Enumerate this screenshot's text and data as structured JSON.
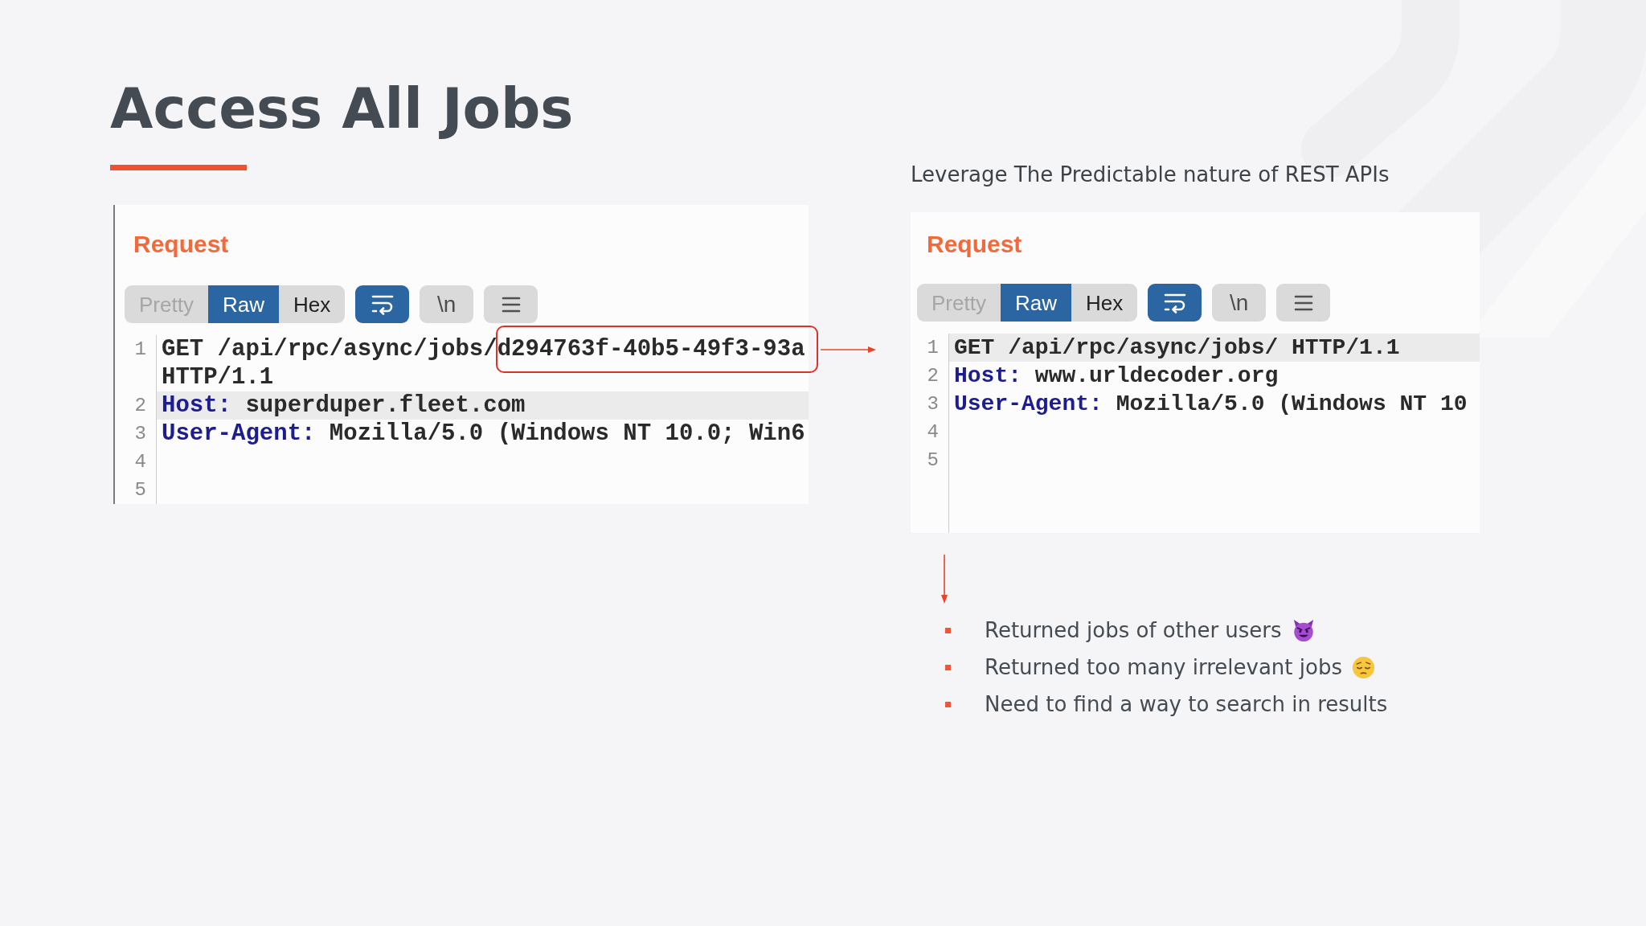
{
  "slide": {
    "title": "Access All Jobs",
    "subtitle": "Leverage The Predictable nature of REST APIs"
  },
  "panels": [
    {
      "heading": "Request",
      "tabs": [
        {
          "label": "Pretty",
          "selected": false,
          "disabled": true
        },
        {
          "label": "Raw",
          "selected": true,
          "disabled": false
        },
        {
          "label": "Hex",
          "selected": false,
          "disabled": false
        }
      ],
      "tools": [
        {
          "kind": "wrap",
          "on": true
        },
        {
          "kind": "newline",
          "label": "\\n",
          "on": false
        },
        {
          "kind": "menu"
        }
      ],
      "lines": [
        {
          "number": "1",
          "kind": "request",
          "text": "GET /api/rpc/async/jobs/",
          "boxed": "d294763f-40b5-49f3-93a",
          "continuation": "HTTP/1.1",
          "highlighted": false
        },
        {
          "number": "2",
          "kind": "header",
          "name": "Host:",
          "value": "superduper.fleet.com",
          "highlighted": true
        },
        {
          "number": "3",
          "kind": "header",
          "name": "User-Agent:",
          "value": "Mozilla/5.0 (Windows NT 10.0; Win6",
          "highlighted": false
        },
        {
          "number": "4",
          "kind": "empty",
          "highlighted": false
        },
        {
          "number": "5",
          "kind": "empty",
          "highlighted": false
        }
      ]
    },
    {
      "heading": "Request",
      "tabs": [
        {
          "label": "Pretty",
          "selected": false,
          "disabled": true
        },
        {
          "label": "Raw",
          "selected": true,
          "disabled": false
        },
        {
          "label": "Hex",
          "selected": false,
          "disabled": false
        }
      ],
      "tools": [
        {
          "kind": "wrap",
          "on": true
        },
        {
          "kind": "newline",
          "label": "\\n",
          "on": false
        },
        {
          "kind": "menu"
        }
      ],
      "lines": [
        {
          "number": "1",
          "kind": "request",
          "text": "GET /api/rpc/async/jobs/ HTTP/1.1",
          "highlighted": true
        },
        {
          "number": "2",
          "kind": "header",
          "name": "Host:",
          "value": "www.urldecoder.org",
          "highlighted": false
        },
        {
          "number": "3",
          "kind": "header",
          "name": "User-Agent:",
          "value": "Mozilla/5.0 (Windows NT 10",
          "highlighted": false
        },
        {
          "number": "4",
          "kind": "empty",
          "highlighted": false
        },
        {
          "number": "5",
          "kind": "empty",
          "highlighted": false
        }
      ]
    }
  ],
  "notes": [
    {
      "text": "Returned jobs of other users",
      "kind": "devil"
    },
    {
      "text": "Returned too many irrelevant jobs",
      "kind": "pensive"
    },
    {
      "text": "Need to find a way to search in results",
      "kind": "plain"
    }
  ]
}
